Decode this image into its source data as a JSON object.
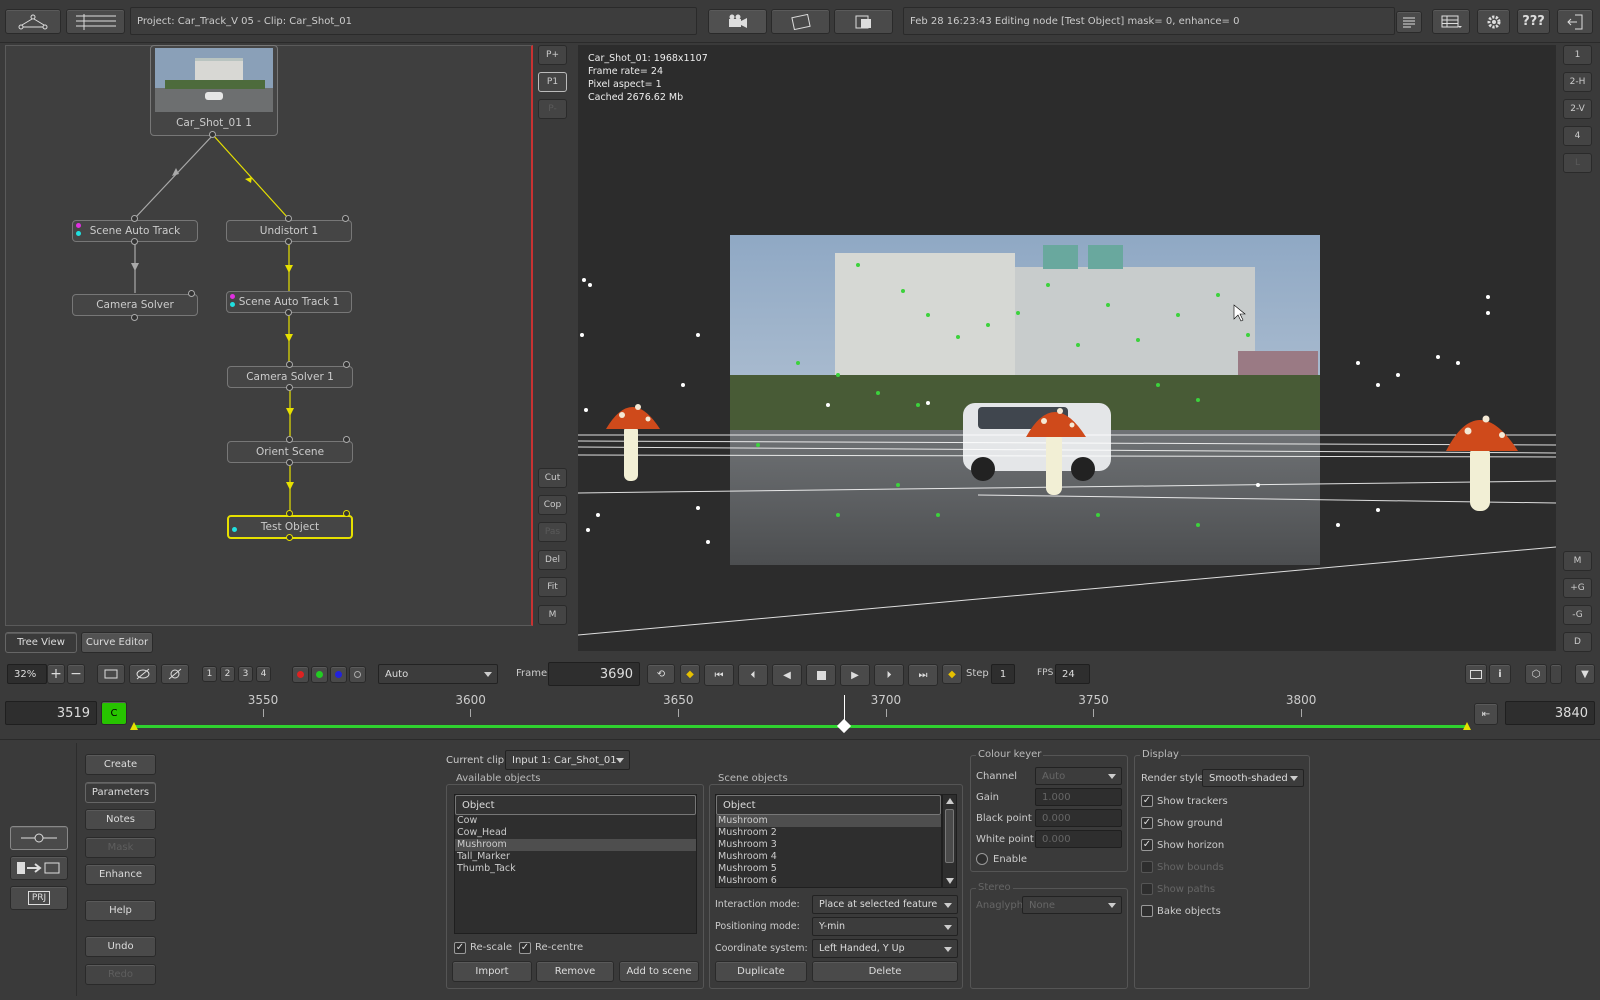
{
  "topbar": {
    "project_label": "Project: Car_Track_V 05 - Clip: Car_Shot_01",
    "status": "Feb 28 16:23:43 Editing node [Test Object] mask= 0, enhance= 0",
    "help_label": "???"
  },
  "nodes": {
    "clip": "Car_Shot_01 1",
    "scene_auto_track": "Scene Auto Track",
    "camera_solver": "Camera Solver",
    "undistort": "Undistort 1",
    "scene_auto_track_1": "Scene Auto Track 1",
    "camera_solver_1": "Camera Solver 1",
    "orient_scene": "Orient Scene",
    "test_object": "Test Object"
  },
  "vertical_tools": {
    "p_plus": "P+",
    "p1": "P1",
    "p_minus": "P-",
    "cut": "Cut",
    "copy": "Cop",
    "paste": "Pas",
    "del": "Del",
    "fit": "Fit",
    "m": "M"
  },
  "tree_tabs": {
    "tree_view": "Tree View",
    "curve_editor": "Curve Editor"
  },
  "viewer": {
    "info_1": "Car_Shot_01: 1968x1107",
    "info_2": "Frame rate= 24",
    "info_3": "Pixel aspect= 1",
    "info_4": "Cached 2676.62 Mb"
  },
  "right_side": {
    "b1": "1",
    "b2h": "2-H",
    "b2v": "2-V",
    "b4": "4",
    "bl": "L",
    "m": "M",
    "plus_g": "+G",
    "minus_g": "-G",
    "d": "D"
  },
  "playbar": {
    "zoom": "32%",
    "views": [
      "1",
      "2",
      "3",
      "4"
    ],
    "mode": "Auto",
    "frame_label": "Frame",
    "frame_value": "3690",
    "step_label": "Step",
    "step_value": "1",
    "fps_label": "FPS",
    "fps_value": "24"
  },
  "timeline": {
    "start": "3519",
    "end": "3840",
    "c_label": "C",
    "ticks": [
      "3550",
      "3600",
      "3650",
      "3700",
      "3750",
      "3800"
    ],
    "current": 3690
  },
  "left_menu": {
    "create": "Create",
    "parameters": "Parameters",
    "notes": "Notes",
    "mask": "Mask",
    "enhance": "Enhance",
    "help": "Help",
    "undo": "Undo",
    "redo": "Redo",
    "prj": "PRJ"
  },
  "clip_panel": {
    "current_clip_label": "Current clip",
    "current_clip_value": "Input 1: Car_Shot_01",
    "available_title": "Available objects",
    "available_header": "Object",
    "available": [
      "Cow",
      "Cow_Head",
      "Mushroom",
      "Tall_Marker",
      "Thumb_Tack"
    ],
    "available_selected": 2,
    "rescale": "Re-scale",
    "recentre": "Re-centre",
    "import": "Import",
    "remove": "Remove",
    "add_to_scene": "Add to scene"
  },
  "scene_panel": {
    "title": "Scene objects",
    "header": "Object",
    "items": [
      "Mushroom",
      "Mushroom 2",
      "Mushroom 3",
      "Mushroom 4",
      "Mushroom 5",
      "Mushroom 6"
    ],
    "selected": 0,
    "interaction_label": "Interaction mode:",
    "interaction_value": "Place at selected feature",
    "positioning_label": "Positioning mode:",
    "positioning_value": "Y-min",
    "coord_label": "Coordinate system:",
    "coord_value": "Left Handed, Y Up",
    "duplicate": "Duplicate",
    "delete": "Delete"
  },
  "keyer": {
    "title": "Colour keyer",
    "channel_label": "Channel",
    "channel_value": "Auto",
    "gain_label": "Gain",
    "gain_value": "1.000",
    "black_label": "Black point",
    "black_value": "0.000",
    "white_label": "White point",
    "white_value": "0.000",
    "enable": "Enable",
    "stereo_title": "Stereo",
    "anaglyph_label": "Anaglyph",
    "anaglyph_value": "None"
  },
  "display": {
    "title": "Display",
    "render_label": "Render style",
    "render_value": "Smooth-shaded",
    "show_trackers": "Show trackers",
    "show_ground": "Show ground",
    "show_horizon": "Show horizon",
    "show_bounds": "Show bounds",
    "show_paths": "Show paths",
    "bake_objects": "Bake objects"
  },
  "colors": {
    "accent": "#e6e000",
    "play_green": "#27c400",
    "timeline_green": "#2fd12f",
    "panel": "#3a3a3a"
  }
}
